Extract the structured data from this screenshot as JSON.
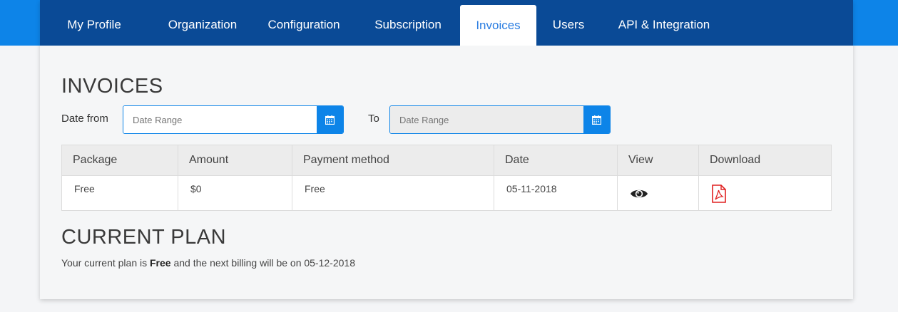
{
  "tabs": [
    {
      "label": "My Profile",
      "active": false
    },
    {
      "label": "Organization",
      "active": false
    },
    {
      "label": "Configuration",
      "active": false
    },
    {
      "label": "Subscription",
      "active": false
    },
    {
      "label": "Invoices",
      "active": true
    },
    {
      "label": "Users",
      "active": false
    },
    {
      "label": "API & Integration",
      "active": false
    }
  ],
  "invoices": {
    "title": "INVOICES",
    "date_from_label": "Date from",
    "date_from_placeholder": "Date Range",
    "to_label": "To",
    "date_to_placeholder": "Date Range",
    "columns": [
      "Package",
      "Amount",
      "Payment method",
      "Date",
      "View",
      "Download"
    ],
    "rows": [
      {
        "package": "Free",
        "amount": "$0",
        "payment_method": "Free",
        "date": "05-11-2018"
      }
    ]
  },
  "current_plan": {
    "title": "CURRENT PLAN",
    "text_prefix": "Your current plan is ",
    "plan_name": "Free",
    "text_suffix": " and the next billing will be on 05-12-2018"
  },
  "colors": {
    "accent": "#0d84e8",
    "tabbar": "#0a4a96",
    "active_tab_text": "#2a7de1",
    "pdf_icon": "#e02020"
  },
  "icons": {
    "calendar": "calendar-icon",
    "view": "eye-icon",
    "download": "pdf-file-icon"
  }
}
